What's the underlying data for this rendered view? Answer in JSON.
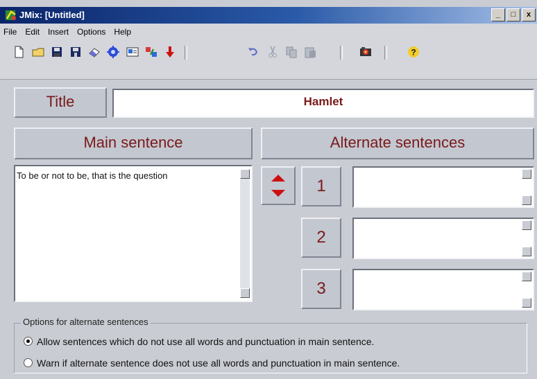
{
  "window": {
    "title": "JMix: [Untitled]",
    "controls": [
      "_",
      "□",
      "x"
    ]
  },
  "menu": [
    {
      "label": "File",
      "key": "F"
    },
    {
      "label": "Edit",
      "key": "E"
    },
    {
      "label": "Insert",
      "key": "I"
    },
    {
      "label": "Options",
      "key": "O"
    },
    {
      "label": "Help",
      "key": "H"
    }
  ],
  "toolbar": {
    "icons": [
      "new-file-icon",
      "open-folder-icon",
      "save-icon",
      "save-as-icon",
      "eraser-icon",
      "gear-blue-icon",
      "web-export-icon",
      "shuffle-icon",
      "arrow-down-icon",
      "undo-icon",
      "cut-icon",
      "copy-icon",
      "paste-icon",
      "camera-icon",
      "help-icon"
    ]
  },
  "title_label": "Title",
  "title_value": "Hamlet",
  "main_sentence_label": "Main sentence",
  "alternate_sentences_label": "Alternate sentences",
  "main_sentence_text": "To be or not to be, that is the question",
  "alternates": [
    {
      "number": "1",
      "value": ""
    },
    {
      "number": "2",
      "value": ""
    },
    {
      "number": "3",
      "value": ""
    }
  ],
  "options": {
    "legend": "Options for alternate sentences",
    "radio1": "Allow sentences which do not use all words and punctuation in main sentence.",
    "radio2": "Warn if alternate sentence does not use all words and punctuation in main sentence.",
    "selected": "radio1"
  },
  "colors": {
    "label_text": "#7a1a1a",
    "arrow_red": "#cc1111"
  }
}
